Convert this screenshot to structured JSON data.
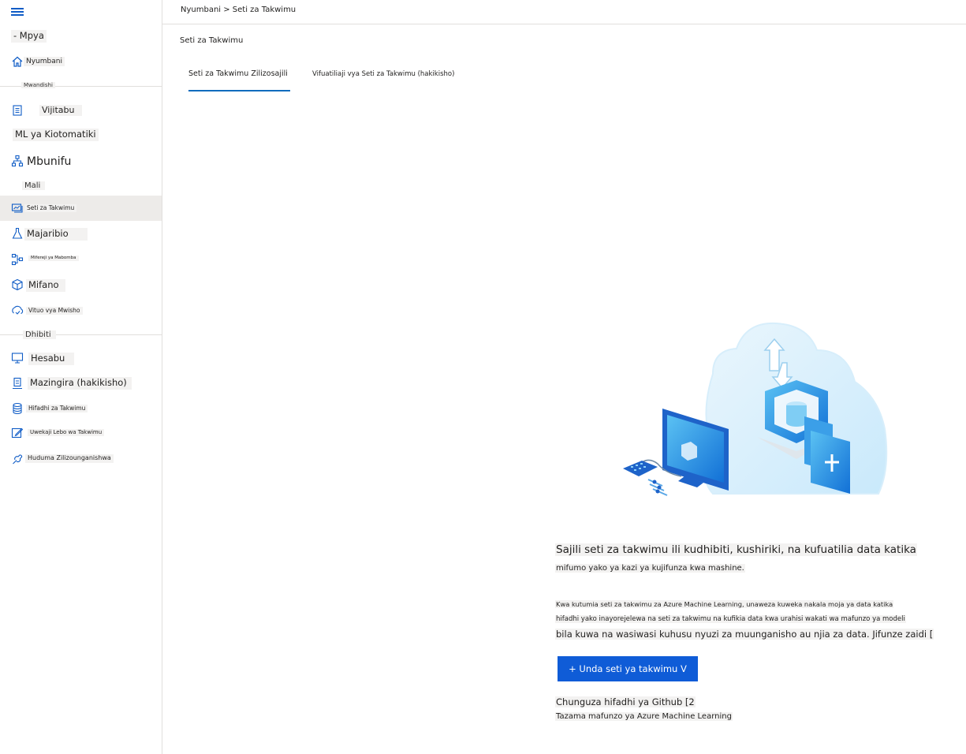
{
  "breadcrumb": "Nyumbani > Seti za Takwimu",
  "page_title": "Seti za Takwimu",
  "sidebar": {
    "new_label": "- Mpya",
    "home_label": "Nyumbani",
    "sections": {
      "author": "Mwandishi",
      "assets": "Mali",
      "manage": "Dhibiti"
    },
    "author_items": [
      {
        "label": "Vijitabu"
      },
      {
        "label": "ML ya Kiotomatiki"
      },
      {
        "label": "Mbunifu"
      }
    ],
    "asset_items": [
      {
        "label": "Seti za Takwimu"
      },
      {
        "label": "Majaribio"
      },
      {
        "label": "Mifereji ya Mabomba"
      },
      {
        "label": "Mifano"
      },
      {
        "label": "Vituo vya Mwisho"
      }
    ],
    "manage_items": [
      {
        "label": "Hesabu"
      },
      {
        "label": "Mazingira (hakikisho)"
      },
      {
        "label": "Hifadhi za Takwimu"
      },
      {
        "label": "Uwekaji Lebo wa Takwimu"
      },
      {
        "label": "Huduma Zilizounganishwa"
      }
    ]
  },
  "tabs": [
    {
      "label": "Seti za Takwimu Zilizosajili"
    },
    {
      "label": "Vifuatiliaji vya Seti za Takwimu (hakikisho)"
    }
  ],
  "empty_state": {
    "heading_line1": "Sajili seti za takwimu ili kudhibiti, kushiriki, na kufuatilia data katika",
    "heading_line2": "mifumo yako ya kazi ya kujifunza kwa mashine.",
    "body_line1": "Kwa kutumia seti za takwimu za Azure Machine Learning, unaweza kuweka nakala moja ya data katika",
    "body_line2": "hifadhi yako inayorejelewa na seti za takwimu na kufikia data kwa urahisi wakati wa mafunzo ya modeli",
    "body_line3": "bila kuwa na wasiwasi kuhusu nyuzi za muunganisho au njia za data. Jifunze zaidi [",
    "create_button": "+ Unda seti ya takwimu V",
    "github_link": "Chunguza hifadhi ya Github [2",
    "training_link": "Tazama mafunzo ya Azure Machine Learning"
  },
  "colors": {
    "accent": "#0f5cd7",
    "active_nav_bg": "#edebe9",
    "icon_blue": "#0f5cc6"
  }
}
